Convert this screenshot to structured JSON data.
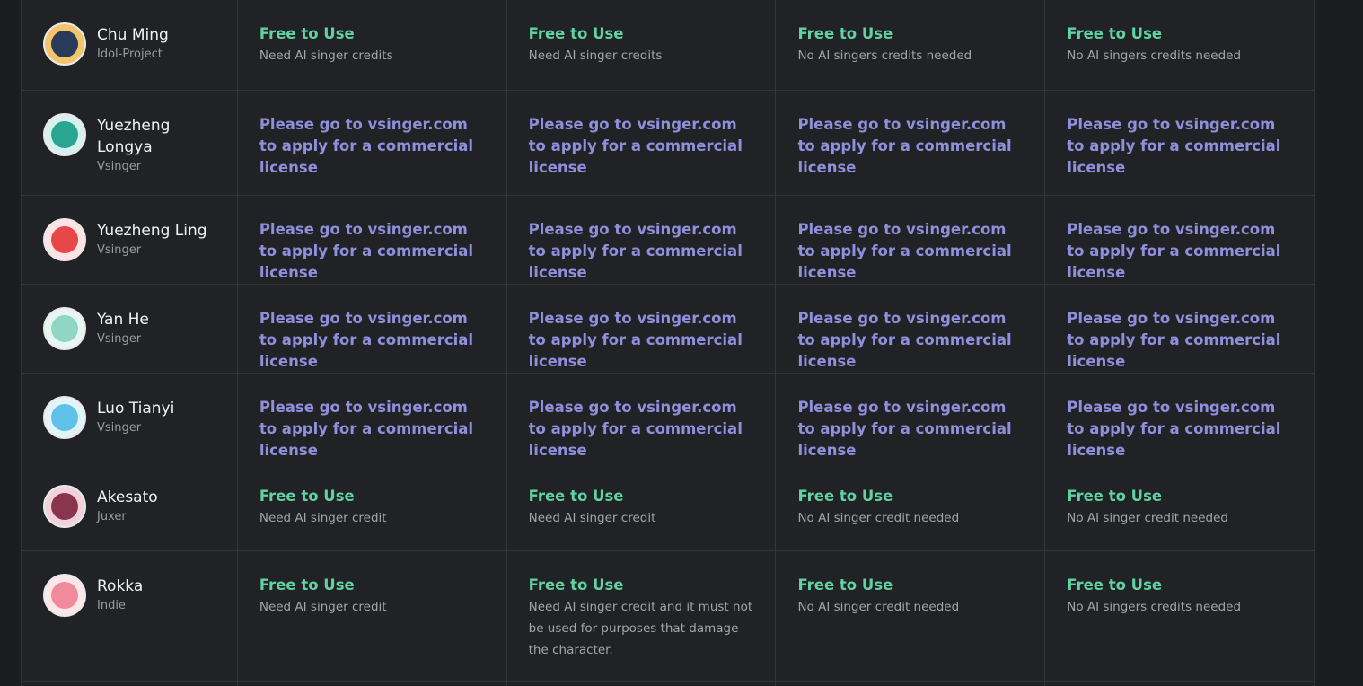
{
  "rows": [
    {
      "name": "Chu Ming",
      "company": "Idol-Project",
      "avatar_icon": "chu-ming-avatar",
      "avatar_colors": [
        "#f3c56a",
        "#2a3a5a"
      ],
      "cells": [
        {
          "status": "Free to Use",
          "note": "Need AI singer credits"
        },
        {
          "status": "Free to Use",
          "note": "Need AI singer credits"
        },
        {
          "status": "Free to Use",
          "note": "No AI singers credits needed"
        },
        {
          "status": "Free to Use",
          "note": "No AI singers credits needed"
        }
      ]
    },
    {
      "name": "Yuezheng Longya",
      "company": "Vsinger",
      "avatar_icon": "yuezheng-longya-logo",
      "avatar_colors": [
        "#2aa58f",
        "#d9f1ec"
      ],
      "cells": [
        {
          "apply": "Please go to vsinger.com to apply for a commercial license"
        },
        {
          "apply": "Please go to vsinger.com to apply for a commercial license"
        },
        {
          "apply": "Please go to vsinger.com to apply for a commercial license"
        },
        {
          "apply": "Please go to vsinger.com to apply for a commercial license"
        }
      ]
    },
    {
      "name": "Yuezheng Ling",
      "company": "Vsinger",
      "avatar_icon": "yuezheng-ling-logo",
      "avatar_colors": [
        "#e8474a",
        "#fde3e3"
      ],
      "cells": [
        {
          "apply": "Please go to vsinger.com to apply for a commercial license"
        },
        {
          "apply": "Please go to vsinger.com to apply for a commercial license"
        },
        {
          "apply": "Please go to vsinger.com to apply for a commercial license"
        },
        {
          "apply": "Please go to vsinger.com to apply for a commercial license"
        }
      ]
    },
    {
      "name": "Yan He",
      "company": "Vsinger",
      "avatar_icon": "yan-he-logo",
      "avatar_colors": [
        "#8fd6c5",
        "#e7f6f1"
      ],
      "cells": [
        {
          "apply": "Please go to vsinger.com to apply for a commercial license"
        },
        {
          "apply": "Please go to vsinger.com to apply for a commercial license"
        },
        {
          "apply": "Please go to vsinger.com to apply for a commercial license"
        },
        {
          "apply": "Please go to vsinger.com to apply for a commercial license"
        }
      ]
    },
    {
      "name": "Luo Tianyi",
      "company": "Vsinger",
      "avatar_icon": "luo-tianyi-logo",
      "avatar_colors": [
        "#5fc1e8",
        "#e2f4fb"
      ],
      "cells": [
        {
          "apply": "Please go to vsinger.com to apply for a commercial license"
        },
        {
          "apply": "Please go to vsinger.com to apply for a commercial license"
        },
        {
          "apply": "Please go to vsinger.com to apply for a commercial license"
        },
        {
          "apply": "Please go to vsinger.com to apply for a commercial license"
        }
      ]
    },
    {
      "name": "Akesato",
      "company": "Juxer",
      "avatar_icon": "akesato-avatar",
      "avatar_colors": [
        "#8a3550",
        "#f1d2dc"
      ],
      "cells": [
        {
          "status": "Free to Use",
          "note": "Need AI singer credit"
        },
        {
          "status": "Free to Use",
          "note": "Need AI singer credit"
        },
        {
          "status": "Free to Use",
          "note": "No AI singer credit needed"
        },
        {
          "status": "Free to Use",
          "note": "No AI singer credit needed"
        }
      ]
    },
    {
      "name": "Rokka",
      "company": "Indie",
      "avatar_icon": "rokka-avatar",
      "avatar_colors": [
        "#f08a9c",
        "#fde6ea"
      ],
      "cells": [
        {
          "status": "Free to Use",
          "note": "Need AI singer credit"
        },
        {
          "status": "Free to Use",
          "note": "Need AI singer credit and it must not be used for purposes that damage the character."
        },
        {
          "status": "Free to Use",
          "note": "No AI singer credit needed"
        },
        {
          "status": "Free to Use",
          "note": "No AI singers credits needed"
        }
      ]
    }
  ]
}
